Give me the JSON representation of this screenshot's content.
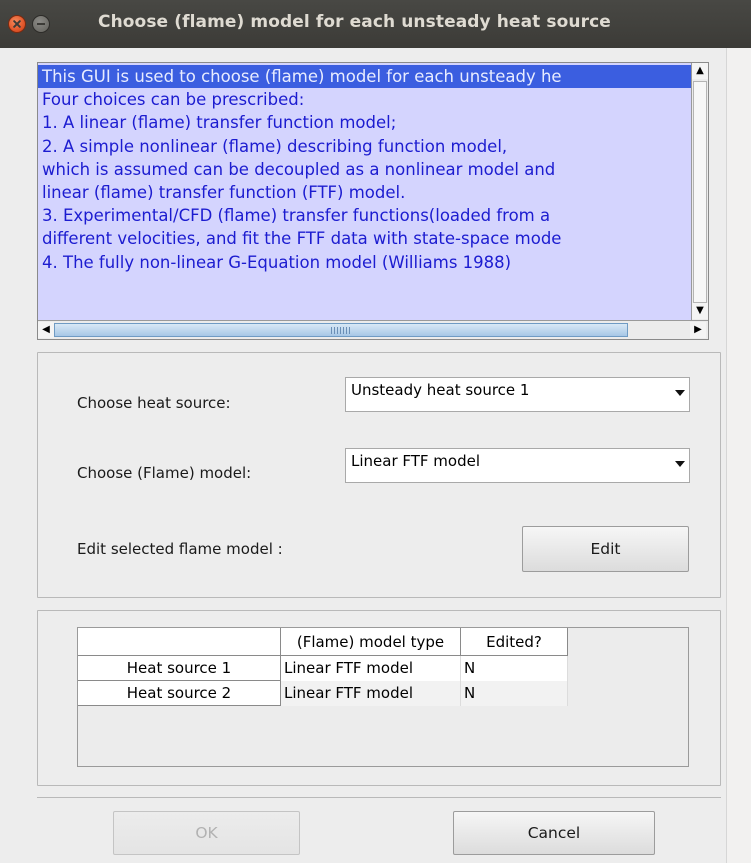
{
  "window": {
    "title": "Choose (flame) model for each unsteady heat source"
  },
  "info": {
    "lines": [
      "This GUI is used to choose (flame) model for each unsteady he",
      "Four choices can be prescribed:",
      "1. A linear (flame) transfer function model;",
      "2. A simple nonlinear (flame) describing function model,",
      "which is assumed can be decoupled as a nonlinear model and",
      "linear (flame) transfer function (FTF) model.",
      "3. Experimental/CFD (flame) transfer functions(loaded from a",
      "different velocities, and fit the FTF data with state-space mode",
      "4. The fully non-linear G-Equation model (Williams 1988)",
      "",
      ""
    ],
    "scroll_up_glyph": "▲",
    "scroll_down_glyph": "▼",
    "scroll_left_glyph": "◀",
    "scroll_right_glyph": "▶"
  },
  "selection": {
    "heat_source_label": "Choose heat source:",
    "heat_source_value": "Unsteady heat source 1",
    "model_label": "Choose (Flame) model:",
    "model_value": "Linear FTF model",
    "edit_label": "Edit selected flame model :",
    "edit_button": "Edit"
  },
  "table": {
    "columns": [
      "",
      "(Flame) model type",
      "Edited?"
    ],
    "rows": [
      {
        "name": "Heat source 1",
        "model": "Linear FTF model",
        "edited": "N"
      },
      {
        "name": "Heat source 2",
        "model": "Linear FTF model",
        "edited": "N"
      }
    ]
  },
  "footer": {
    "ok_button": "OK",
    "cancel_button": "Cancel"
  },
  "colors": {
    "titlebar": "#3c3b37",
    "listbox_bg": "#d4d4fe",
    "listbox_text": "#1c1cd0",
    "selection": "#3b5ee0",
    "close_button": "#e0562a"
  }
}
